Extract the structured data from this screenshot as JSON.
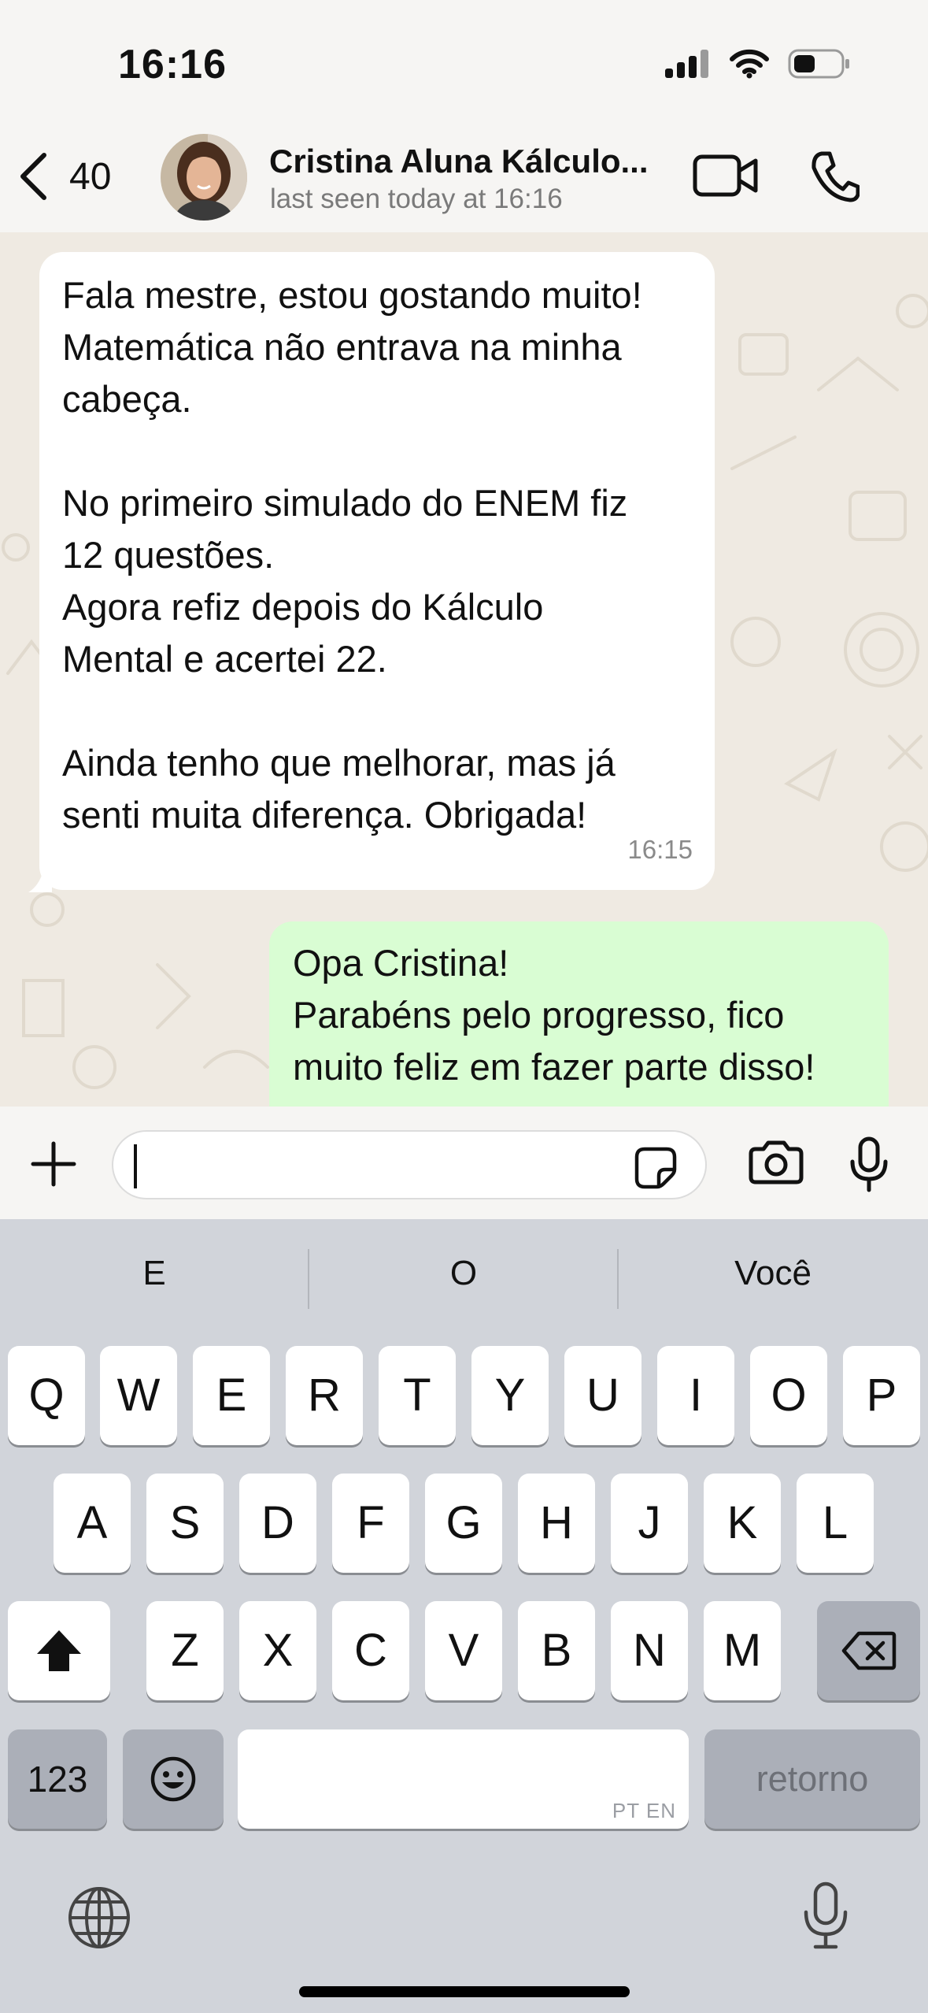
{
  "status_bar": {
    "time": "16:16",
    "icons": [
      "cellular-signal-icon",
      "wifi-icon",
      "battery-icon"
    ]
  },
  "header": {
    "back_count": "40",
    "contact_name": "Cristina Aluna Kálculo...",
    "last_seen": "last seen today at 16:16",
    "icons": [
      "chevron-left-icon",
      "video-camera-icon",
      "phone-icon"
    ]
  },
  "messages": [
    {
      "direction": "incoming",
      "text": "Fala mestre, estou gostando muito!\nMatemática não entrava na minha\ncabeça.\n\nNo primeiro simulado do ENEM fiz\n12 questões.\nAgora refiz depois do Kálculo\nMental e acertei 22.\n\nAinda tenho que melhorar, mas já\nsenti muita diferença. Obrigada!",
      "time": "16:15"
    },
    {
      "direction": "outgoing",
      "text": "Opa Cristina!\nParabéns pelo progresso, fico\nmuito feliz em fazer parte disso!"
    }
  ],
  "input_bar": {
    "value": "",
    "icons": [
      "plus-icon",
      "sticker-icon",
      "camera-icon",
      "microphone-icon"
    ]
  },
  "keyboard": {
    "suggestions": [
      "E",
      "O",
      "Você"
    ],
    "row1": [
      "Q",
      "W",
      "E",
      "R",
      "T",
      "Y",
      "U",
      "I",
      "O",
      "P"
    ],
    "row2": [
      "A",
      "S",
      "D",
      "F",
      "G",
      "H",
      "J",
      "K",
      "L"
    ],
    "row3": [
      "Z",
      "X",
      "C",
      "V",
      "B",
      "N",
      "M"
    ],
    "numbers_label": "123",
    "space_language": "PT EN",
    "return_label": "retorno",
    "icons": [
      "shift-icon",
      "backspace-icon",
      "emoji-icon",
      "globe-icon",
      "microphone-icon"
    ]
  },
  "colors": {
    "incoming_bubble": "#ffffff",
    "outgoing_bubble": "#d9fdd3",
    "chat_background": "#efeae2",
    "keyboard_background": "#d1d4da"
  }
}
